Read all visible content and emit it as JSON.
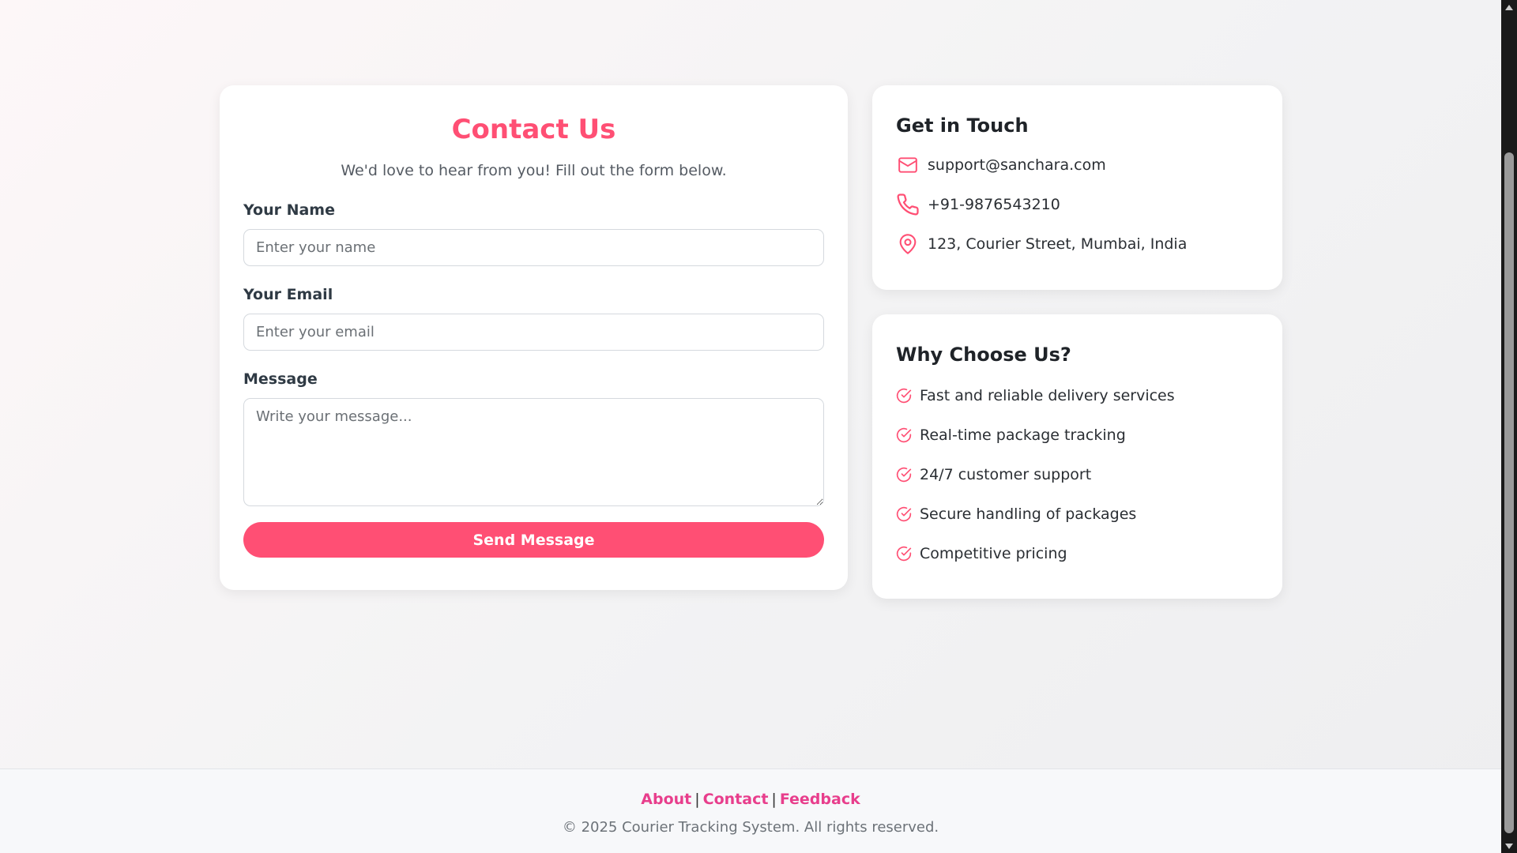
{
  "contact_form": {
    "title": "Contact Us",
    "subtitle": "We'd love to hear from you! Fill out the form below.",
    "name_label": "Your Name",
    "name_placeholder": "Enter your name",
    "email_label": "Your Email",
    "email_placeholder": "Enter your email",
    "message_label": "Message",
    "message_placeholder": "Write your message...",
    "submit_label": "Send Message"
  },
  "get_in_touch": {
    "title": "Get in Touch",
    "items": [
      {
        "icon": "mail-icon",
        "text": "support@sanchara.com"
      },
      {
        "icon": "phone-icon",
        "text": "+91-9876543210"
      },
      {
        "icon": "location-pin-icon",
        "text": "123, Courier Street, Mumbai, India"
      }
    ]
  },
  "why_choose_us": {
    "title": "Why Choose Us?",
    "items": [
      {
        "icon": "check-circle-icon",
        "text": "Fast and reliable delivery services"
      },
      {
        "icon": "check-circle-icon",
        "text": "Real-time package tracking"
      },
      {
        "icon": "check-circle-icon",
        "text": "24/7 customer support"
      },
      {
        "icon": "check-circle-icon",
        "text": "Secure handling of packages"
      },
      {
        "icon": "check-circle-icon",
        "text": "Competitive pricing"
      }
    ]
  },
  "footer": {
    "links": [
      "About",
      "Contact",
      "Feedback"
    ],
    "separator": "|",
    "copyright": "© 2025 Courier Tracking System. All rights reserved."
  },
  "colors": {
    "accent": "#ff4f74",
    "footer_link": "#e83e8c"
  }
}
